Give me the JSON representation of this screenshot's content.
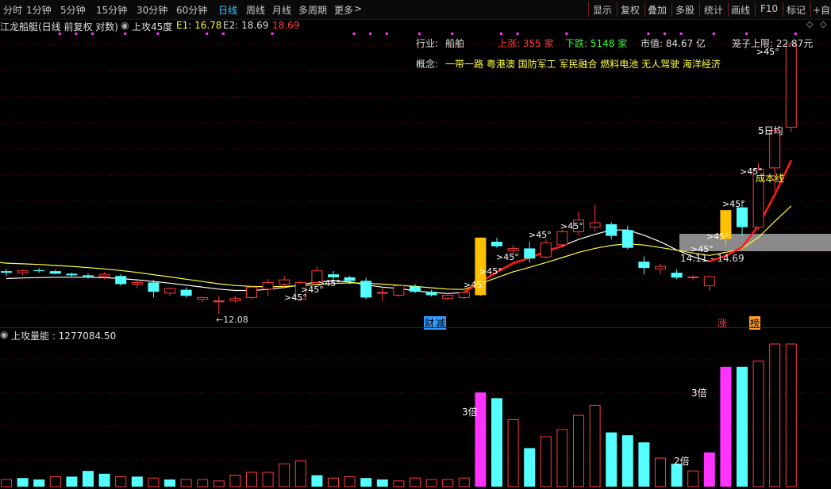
{
  "toolbar": {
    "periods": [
      "分时",
      "1分钟",
      "5分钟",
      "15分钟",
      "30分钟",
      "60分钟",
      "日线",
      "周线",
      "月线",
      "多周期",
      "更多"
    ],
    "active_period": "日线",
    "more_arrow": ">",
    "right_buttons": [
      "显示",
      "复权",
      "叠加",
      "多股",
      "统计",
      "画线",
      "F10",
      "标记",
      "+自选"
    ]
  },
  "header": {
    "stock_title": "江龙船艇(日线 前复权 对数)",
    "indicator_name": "上攻45度",
    "e1_label": "E1: 16.78",
    "e2_label": "E2: 18.69",
    "e3_value": "18.69"
  },
  "info": {
    "industry_label": "行业:",
    "industry_value": "船舶",
    "up_label": "上涨: 355 家",
    "down_label": "下跌: 5148 家",
    "mktcap_label": "市值: 84.67 亿",
    "cage_label": "笼子上限: 22.87元",
    "concept_label": "概念:",
    "concepts": "一带一路 粤港澳 国防军工 军民融合 燃料电池 无人驾驶 海洋经济"
  },
  "annotations": {
    "low_price": "12.08",
    "angle": ">45°",
    "ma5_label": "5日均",
    "cost_line_label": "成本线",
    "range_label": "14.11 - 14.69",
    "event_finance": "财",
    "event_reduce": "减",
    "event_rise": "涨",
    "event_list": "榜",
    "vol_3x": "3倍",
    "vol_2x": "2倍"
  },
  "volume_panel": {
    "title": "上攻量能 : 1277084.50"
  },
  "colors": {
    "up": "#ff3c3c",
    "down": "#54ffff",
    "ma_white": "#ffffff",
    "ma_yellow": "#ffff3c",
    "signal_yellow": "#ffc000",
    "magenta": "#ff33ff",
    "grid": "#8b0000"
  },
  "chart_data": {
    "type": "candlestick",
    "note_scale": "log price",
    "ohlc": [
      [
        13.35,
        13.42,
        13.2,
        13.3
      ],
      [
        13.3,
        13.4,
        13.22,
        13.36
      ],
      [
        13.38,
        13.45,
        13.3,
        13.35
      ],
      [
        13.35,
        13.4,
        13.25,
        13.27
      ],
      [
        13.27,
        13.3,
        13.18,
        13.22
      ],
      [
        13.22,
        13.28,
        13.12,
        13.18
      ],
      [
        13.18,
        13.32,
        13.1,
        13.25
      ],
      [
        13.2,
        13.26,
        12.9,
        12.95
      ],
      [
        12.95,
        13.05,
        12.82,
        13.0
      ],
      [
        13.0,
        13.08,
        12.55,
        12.72
      ],
      [
        12.68,
        12.85,
        12.6,
        12.82
      ],
      [
        12.78,
        12.85,
        12.55,
        12.6
      ],
      [
        12.5,
        12.58,
        12.42,
        12.55
      ],
      [
        12.45,
        12.6,
        12.08,
        12.45
      ],
      [
        12.45,
        12.6,
        12.4,
        12.52
      ],
      [
        12.55,
        12.9,
        12.5,
        12.86
      ],
      [
        12.8,
        13.1,
        12.6,
        13.0
      ],
      [
        12.95,
        13.2,
        12.82,
        13.08
      ],
      [
        12.5,
        13.05,
        12.45,
        13.0
      ],
      [
        13.0,
        13.5,
        12.95,
        13.36
      ],
      [
        13.25,
        13.35,
        13.1,
        13.16
      ],
      [
        13.16,
        13.2,
        12.95,
        13.05
      ],
      [
        13.05,
        13.15,
        12.5,
        12.55
      ],
      [
        12.7,
        12.85,
        12.45,
        12.7
      ],
      [
        12.62,
        12.92,
        12.58,
        12.9
      ],
      [
        12.88,
        12.95,
        12.68,
        12.72
      ],
      [
        12.72,
        12.78,
        12.58,
        12.62
      ],
      [
        12.52,
        12.68,
        12.48,
        12.62
      ],
      [
        12.55,
        12.75,
        12.5,
        12.7
      ],
      [
        12.62,
        14.44,
        12.6,
        14.44
      ],
      [
        14.3,
        14.44,
        14.1,
        14.15
      ],
      [
        14.0,
        14.2,
        13.85,
        14.08
      ],
      [
        14.08,
        14.3,
        13.62,
        13.75
      ],
      [
        13.8,
        14.4,
        13.75,
        14.27
      ],
      [
        14.2,
        14.7,
        14.1,
        14.64
      ],
      [
        14.64,
        15.35,
        14.5,
        15.05
      ],
      [
        14.8,
        15.6,
        14.65,
        14.95
      ],
      [
        14.9,
        14.97,
        14.38,
        14.5
      ],
      [
        14.7,
        14.85,
        14.05,
        14.1
      ],
      [
        13.65,
        13.82,
        13.25,
        13.45
      ],
      [
        13.42,
        13.58,
        13.25,
        13.5
      ],
      [
        13.3,
        13.41,
        13.1,
        13.15
      ],
      [
        13.15,
        13.22,
        13.08,
        13.17
      ],
      [
        12.9,
        13.2,
        12.75,
        13.18
      ],
      [
        14.4,
        15.4,
        14.2,
        15.4
      ],
      [
        15.5,
        15.75,
        14.5,
        14.8
      ],
      [
        14.8,
        17.2,
        14.7,
        16.95
      ],
      [
        17.0,
        18.68,
        16.1,
        18.55
      ],
      [
        18.7,
        22.87,
        18.5,
        22.72
      ]
    ],
    "ma_white": [
      13.12,
      13.14,
      13.15,
      13.16,
      13.16,
      13.16,
      13.15,
      13.12,
      13.08,
      13.03,
      12.98,
      12.92,
      12.86,
      12.8,
      12.76,
      12.76,
      12.79,
      12.85,
      12.93,
      13.02,
      13.05,
      13.02,
      12.93,
      12.86,
      12.82,
      12.75,
      12.7,
      12.67,
      12.7,
      13.02,
      13.32,
      13.6,
      13.77,
      13.98,
      14.16,
      14.38,
      14.55,
      14.7,
      14.7,
      14.52,
      14.3,
      14.03,
      13.81,
      13.66,
      13.84,
      14.12,
      14.85,
      15.97,
      17.3
    ],
    "ma_yellow": [
      13.6,
      13.58,
      13.56,
      13.53,
      13.5,
      13.46,
      13.42,
      13.37,
      13.31,
      13.24,
      13.17,
      13.1,
      13.03,
      12.96,
      12.91,
      12.88,
      12.87,
      12.88,
      12.9,
      12.94,
      12.97,
      12.99,
      12.98,
      12.95,
      12.92,
      12.88,
      12.84,
      12.8,
      12.79,
      12.97,
      13.15,
      13.33,
      13.47,
      13.62,
      13.78,
      13.95,
      14.08,
      14.18,
      14.23,
      14.19,
      14.11,
      14.02,
      13.93,
      13.85,
      13.95,
      14.08,
      14.45,
      15.0,
      15.55
    ],
    "volume": [
      [
        0.05,
        "up"
      ],
      [
        0.06,
        "down"
      ],
      [
        0.05,
        "down"
      ],
      [
        0.07,
        "up"
      ],
      [
        0.07,
        "down"
      ],
      [
        0.11,
        "down"
      ],
      [
        0.09,
        "down"
      ],
      [
        0.07,
        "up"
      ],
      [
        0.07,
        "down"
      ],
      [
        0.06,
        "up"
      ],
      [
        0.05,
        "down"
      ],
      [
        0.05,
        "up"
      ],
      [
        0.05,
        "up"
      ],
      [
        0.04,
        "up"
      ],
      [
        0.08,
        "up"
      ],
      [
        0.1,
        "up"
      ],
      [
        0.1,
        "up"
      ],
      [
        0.16,
        "up"
      ],
      [
        0.18,
        "up"
      ],
      [
        0.08,
        "down"
      ],
      [
        0.06,
        "up"
      ],
      [
        0.07,
        "up"
      ],
      [
        0.06,
        "down"
      ],
      [
        0.05,
        "down"
      ],
      [
        0.04,
        "up"
      ],
      [
        0.06,
        "up"
      ],
      [
        0.05,
        "up"
      ],
      [
        0.05,
        "up"
      ],
      [
        0.06,
        "up"
      ],
      [
        0.66,
        "magenta"
      ],
      [
        0.62,
        "down"
      ],
      [
        0.47,
        "up"
      ],
      [
        0.27,
        "down"
      ],
      [
        0.35,
        "up"
      ],
      [
        0.4,
        "up"
      ],
      [
        0.5,
        "up"
      ],
      [
        0.57,
        "up"
      ],
      [
        0.38,
        "down"
      ],
      [
        0.36,
        "down"
      ],
      [
        0.31,
        "down"
      ],
      [
        0.2,
        "up"
      ],
      [
        0.16,
        "down"
      ],
      [
        0.11,
        "up"
      ],
      [
        0.24,
        "magenta"
      ],
      [
        0.84,
        "magenta"
      ],
      [
        0.84,
        "down"
      ],
      [
        0.88,
        "up"
      ],
      [
        1.0,
        "up"
      ],
      [
        1.0,
        "up"
      ]
    ]
  }
}
